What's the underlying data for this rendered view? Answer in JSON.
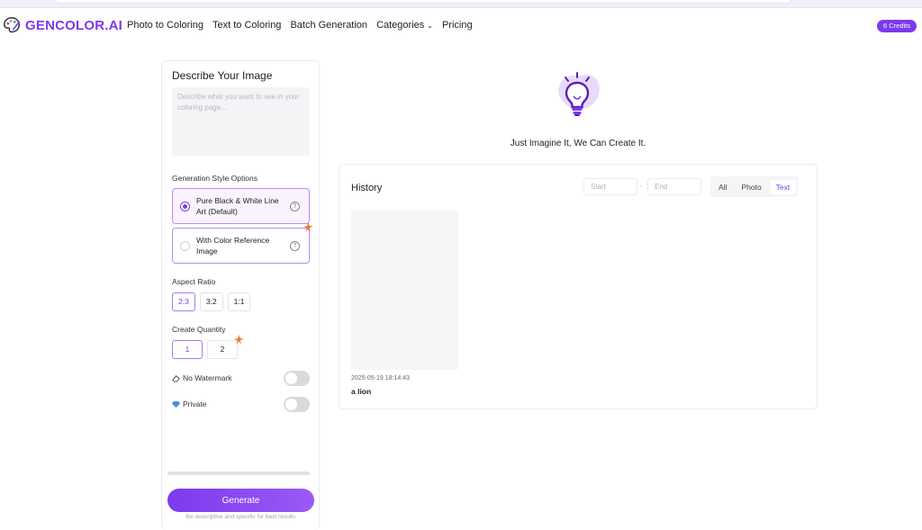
{
  "header": {
    "brand": "GENCOLOR.AI",
    "nav": [
      {
        "label": "Photo to Coloring"
      },
      {
        "label": "Text to Coloring"
      },
      {
        "label": "Batch Generation"
      },
      {
        "label": "Categories"
      },
      {
        "label": "Pricing"
      }
    ],
    "categories_chevron": "⌄",
    "credits": "6 Credits"
  },
  "panel": {
    "title": "Describe Your Image",
    "prompt_value": "",
    "prompt_placeholder": "Describe what you want to see in your coloring page...",
    "style_label": "Generation Style Options",
    "style_options": [
      {
        "label": "Pure Black & White Line Art (Default)",
        "selected": true,
        "help": "?"
      },
      {
        "label": "With Color Reference Image",
        "selected": false,
        "help": "?"
      }
    ],
    "aspect_label": "Aspect Ratio",
    "aspect_options": [
      {
        "label": "2:3",
        "selected": true
      },
      {
        "label": "3:2",
        "selected": false
      },
      {
        "label": "1:1",
        "selected": false
      }
    ],
    "quantity_label": "Create Quantity",
    "quantity_options": [
      {
        "label": "1",
        "selected": true
      },
      {
        "label": "2",
        "selected": false
      }
    ],
    "no_watermark_label": "No Watermark",
    "no_watermark_on": false,
    "private_label": "Private",
    "private_on": false,
    "progress": 0,
    "generate_label": "Generate",
    "generate_hint": "Be descriptive and specific for best results"
  },
  "hero": {
    "tagline": "Just Imagine It, We Can Create It.",
    "icon": "lightbulb-icon"
  },
  "history": {
    "title": "History",
    "start_placeholder": "Start",
    "separator": "-",
    "end_placeholder": "End",
    "filters": [
      {
        "label": "All",
        "selected": false
      },
      {
        "label": "Photo",
        "selected": false
      },
      {
        "label": "Text",
        "selected": true
      }
    ],
    "items": [
      {
        "date": "2025-05-19 18:14:43",
        "prompt": "a lion"
      }
    ]
  },
  "colors": {
    "accent": "#7c3aed",
    "accent_light": "#b88bf5",
    "spark": "#f07a3a"
  }
}
